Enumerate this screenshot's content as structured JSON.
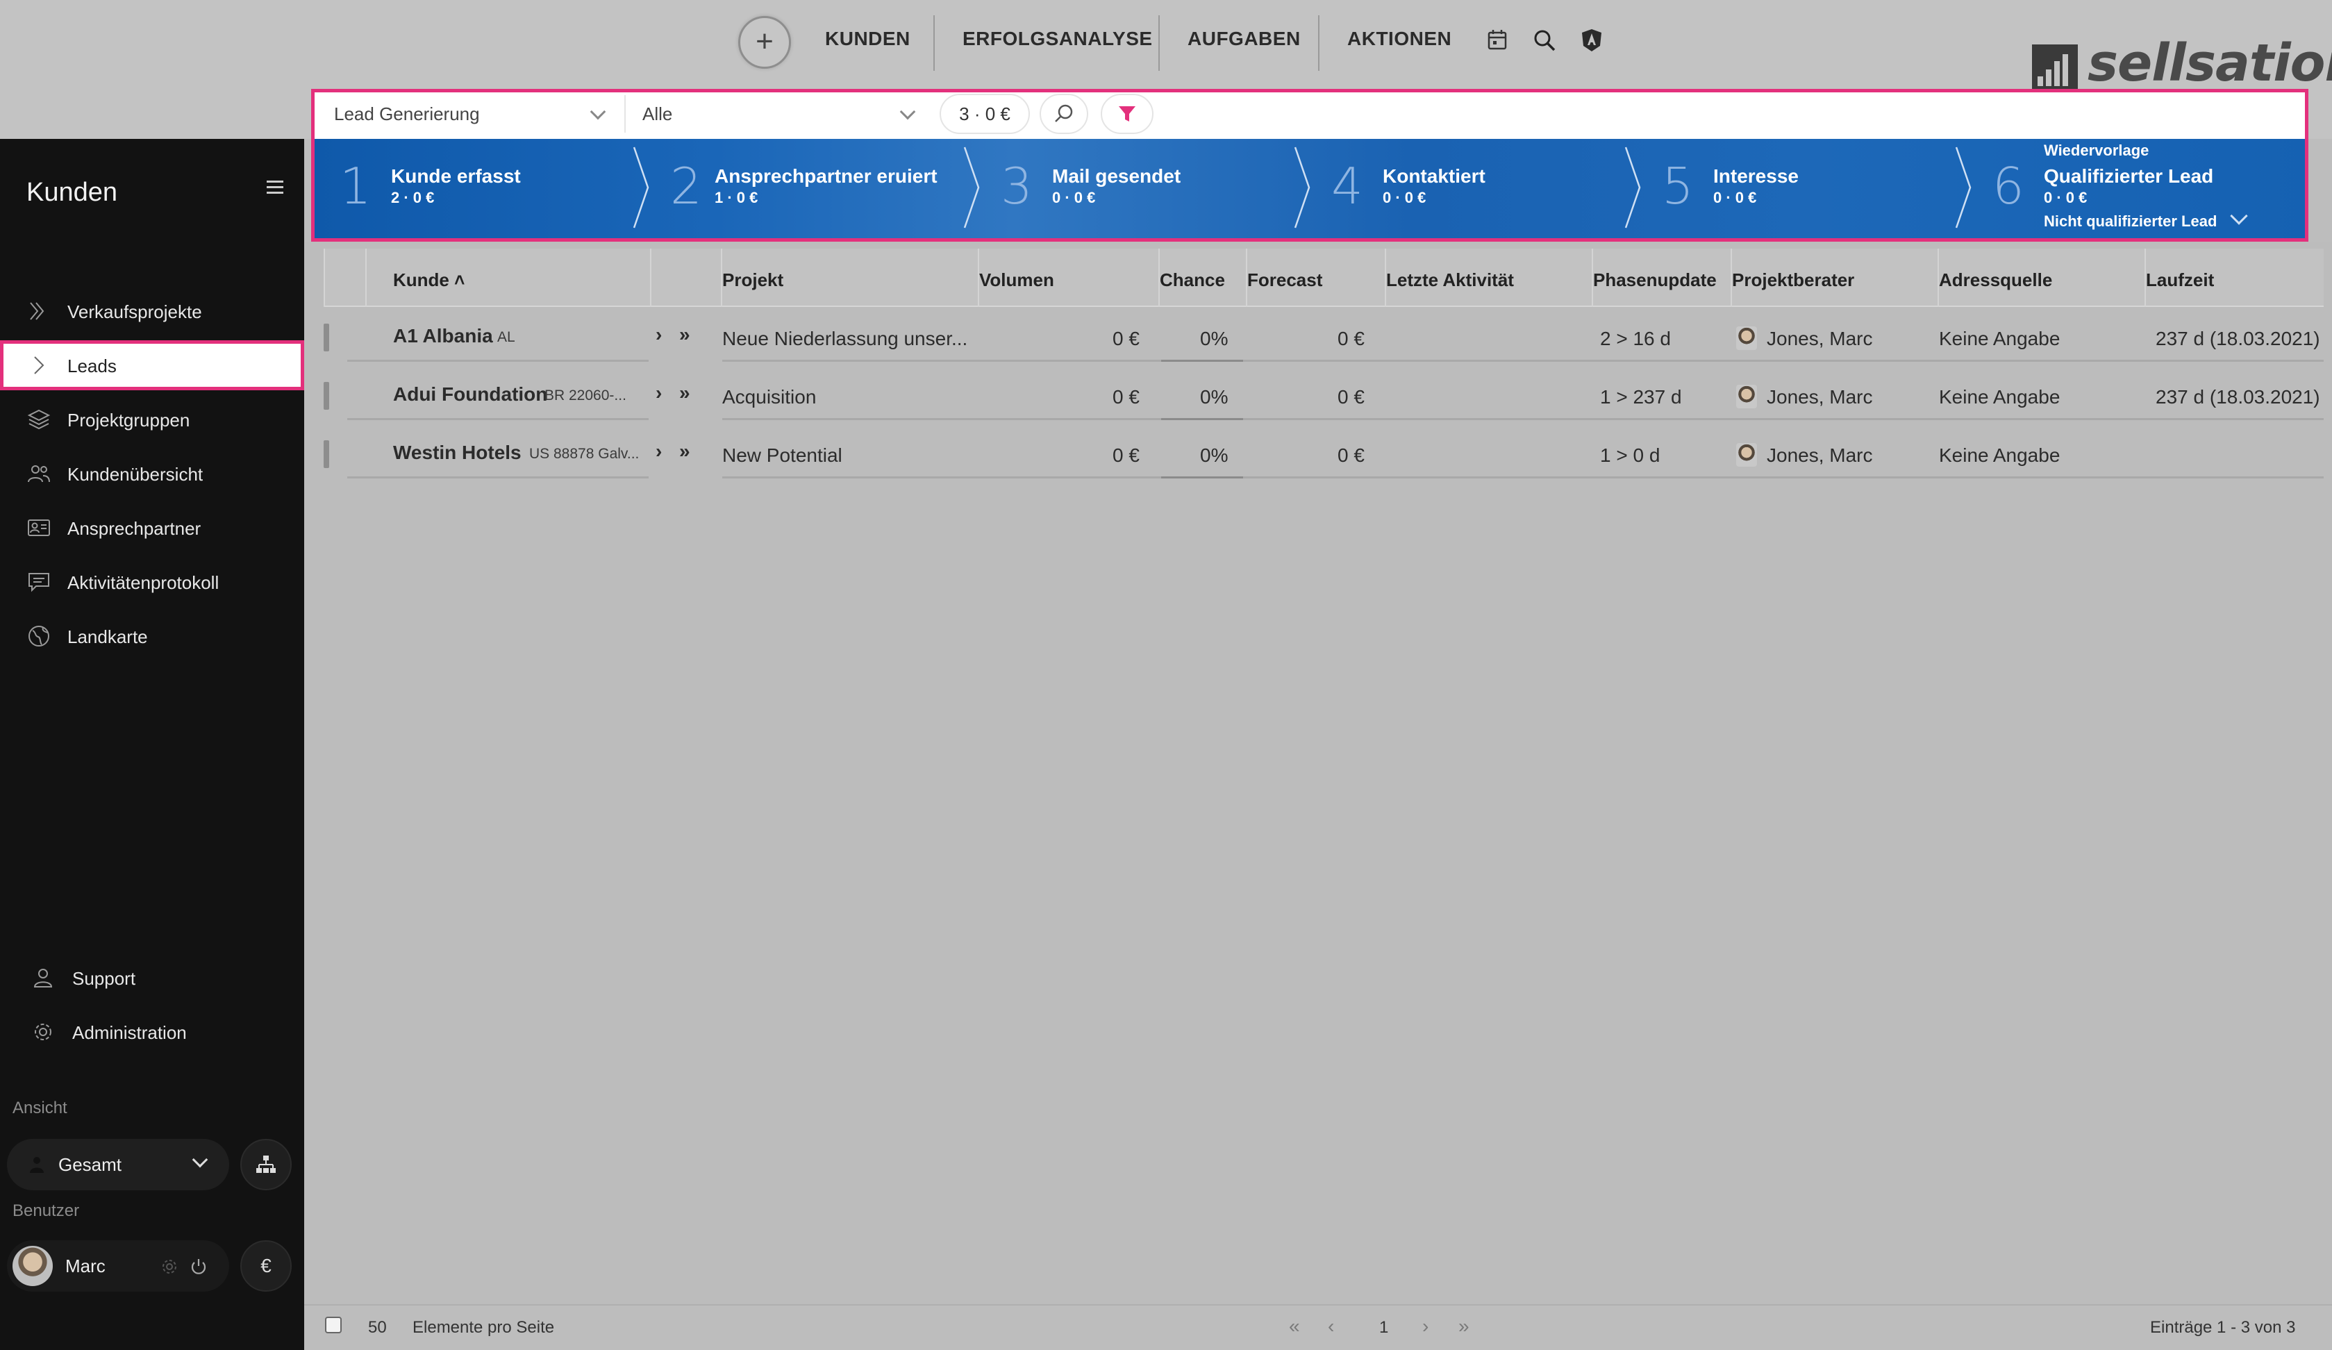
{
  "topbar": {
    "plus_label": "+",
    "nav": [
      "KUNDEN",
      "ERFOLGSANALYSE",
      "AUFGABEN",
      "AKTIONEN"
    ],
    "icons": [
      "calendar-icon",
      "search-icon",
      "shield-icon"
    ],
    "logo_text": "sellsation"
  },
  "filter": {
    "pipeline": "Lead Generierung",
    "scope": "Alle",
    "summary": "3 ·  0 €"
  },
  "phases": [
    {
      "num": "1",
      "label": "Kunde erfasst",
      "sub": "2 ·  0 €"
    },
    {
      "num": "2",
      "label": "Ansprechpartner eruiert",
      "sub": "1 ·  0 €"
    },
    {
      "num": "3",
      "label": "Mail gesendet",
      "sub": "0 ·  0 €"
    },
    {
      "num": "4",
      "label": "Kontaktiert",
      "sub": "0 ·  0 €"
    },
    {
      "num": "5",
      "label": "Interesse",
      "sub": "0 ·  0 €"
    },
    {
      "num": "6",
      "label": "Qualifizierter Lead",
      "sub": "0 ·  0 €",
      "above": "Wiedervorlage",
      "below": "Nicht qualifizierter Lead"
    }
  ],
  "sidebar": {
    "title": "Kunden",
    "items": [
      {
        "label": "Verkaufsprojekte",
        "icon": "double-chevron-icon"
      },
      {
        "label": "Leads",
        "icon": "chevron-right-icon",
        "active": true
      },
      {
        "label": "Projektgruppen",
        "icon": "layers-icon"
      },
      {
        "label": "Kundenübersicht",
        "icon": "users-icon"
      },
      {
        "label": "Ansprechpartner",
        "icon": "contact-card-icon"
      },
      {
        "label": "Aktivitätenprotokoll",
        "icon": "chat-icon"
      },
      {
        "label": "Landkarte",
        "icon": "globe-icon"
      }
    ],
    "support": "Support",
    "administration": "Administration",
    "view_label": "Ansicht",
    "view_value": "Gesamt",
    "user_label": "Benutzer",
    "user_name": "Marc",
    "currency_symbol": "€"
  },
  "table": {
    "columns": [
      "Kunde",
      "Projekt",
      "Volumen",
      "Chance",
      "Forecast",
      "Letzte Aktivität",
      "Phasenupdate",
      "Projektberater",
      "Adressquelle",
      "Laufzeit"
    ],
    "sort_indicator": "˄",
    "rows": [
      {
        "kunde": "A1 Albania",
        "code": "AL",
        "projekt": "Neue Niederlassung unser...",
        "volumen": "0 €",
        "chance": "0%",
        "forecast": "0 €",
        "aktivitaet": "",
        "phase": "2 > 16 d",
        "berater": "Jones, Marc",
        "quelle": "Keine Angabe",
        "laufzeit": "237 d (18.03.2021)"
      },
      {
        "kunde": "Adui Foundation",
        "code": "BR 22060-...",
        "projekt": "Acquisition",
        "volumen": "0 €",
        "chance": "0%",
        "forecast": "0 €",
        "aktivitaet": "",
        "phase": "1 > 237 d",
        "berater": "Jones, Marc",
        "quelle": "Keine Angabe",
        "laufzeit": "237 d (18.03.2021)"
      },
      {
        "kunde": "Westin Hotels",
        "code": "US 88878 Galv...",
        "projekt": "New Potential",
        "volumen": "0 €",
        "chance": "0%",
        "forecast": "0 €",
        "aktivitaet": "",
        "phase": "1 > 0 d",
        "berater": "Jones, Marc",
        "quelle": "Keine Angabe",
        "laufzeit": ""
      }
    ]
  },
  "footer": {
    "page_size": "50",
    "page_size_label": "Elemente pro Seite",
    "page": "1",
    "entries": "Einträge 1 - 3 von 3"
  },
  "colors": {
    "accent": "#e3307c",
    "phase_blue": "#1a64b4",
    "sidebar_bg": "#121212"
  }
}
